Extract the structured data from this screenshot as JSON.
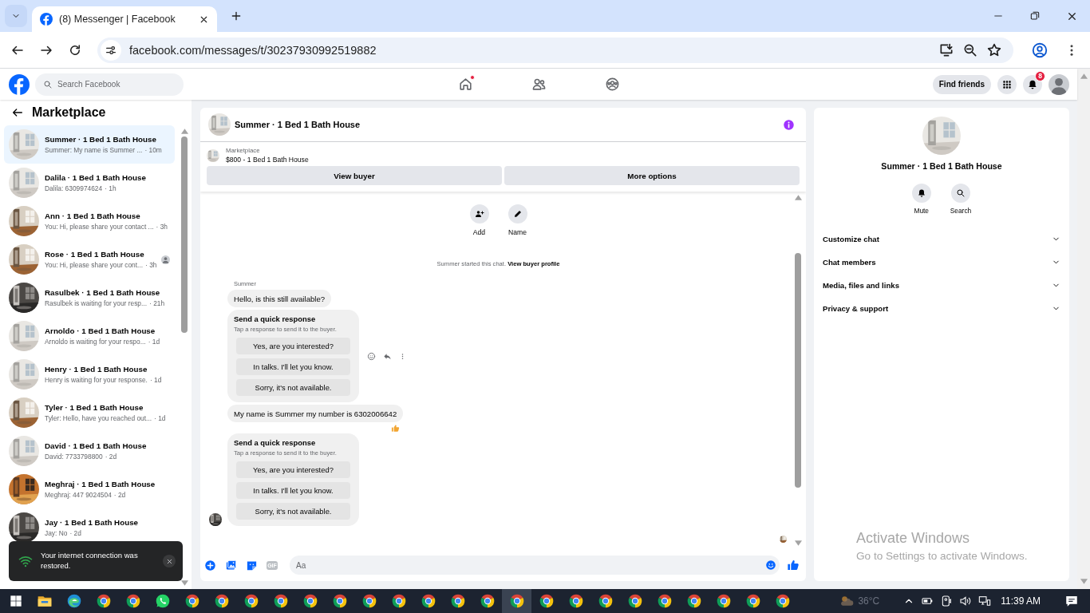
{
  "browser": {
    "tab_title": "(8) Messenger | Facebook",
    "url": "facebook.com/messages/t/30237930992519882"
  },
  "topbar": {
    "search_placeholder": "Search Facebook",
    "nav": [
      {
        "kind": "home",
        "has_dot": true
      },
      {
        "kind": "friends",
        "has_dot": false
      },
      {
        "kind": "groups",
        "has_dot": false
      }
    ],
    "find_friends": "Find friends",
    "notification_count": "8"
  },
  "sidebar": {
    "title": "Marketplace",
    "conversations": [
      {
        "title": "Summer · 1 Bed 1 Bath House",
        "preview": "Summer: My name is Summer ...",
        "time": "· 10m",
        "selected": true,
        "seen_avatar": false
      },
      {
        "title": "Dalila · 1 Bed 1 Bath House",
        "preview": "Dalila: 6309974624",
        "time": "· 1h",
        "selected": false,
        "seen_avatar": false
      },
      {
        "title": "Ann · 1 Bed 1 Bath House",
        "preview": "You: Hi, please share your contact ...",
        "time": "· 3h",
        "selected": false,
        "seen_avatar": false
      },
      {
        "title": "Rose · 1 Bed 1 Bath House",
        "preview": "You: Hi, please share your cont...",
        "time": "· 3h",
        "selected": false,
        "seen_avatar": true
      },
      {
        "title": "Rasulbek · 1 Bed 1 Bath House",
        "preview": "Rasulbek is waiting for your resp...",
        "time": "· 21h",
        "selected": false,
        "seen_avatar": false
      },
      {
        "title": "Arnoldo · 1 Bed 1 Bath House",
        "preview": "Arnoldo is waiting for your respo...",
        "time": "· 1d",
        "selected": false,
        "seen_avatar": false
      },
      {
        "title": "Henry · 1 Bed 1 Bath House",
        "preview": "Henry is waiting for your response.",
        "time": "· 1d",
        "selected": false,
        "seen_avatar": false
      },
      {
        "title": "Tyler · 1 Bed 1 Bath House",
        "preview": "Tyler: Hello, have you reached out...",
        "time": "· 1d",
        "selected": false,
        "seen_avatar": false
      },
      {
        "title": "David · 1 Bed 1 Bath House",
        "preview": "David: 7733798800",
        "time": "· 2d",
        "selected": false,
        "seen_avatar": false
      },
      {
        "title": "Meghraj · 1 Bed 1 Bath House",
        "preview": "Meghraj: 447 9024504",
        "time": "· 2d",
        "selected": false,
        "seen_avatar": false
      },
      {
        "title": "Jay · 1 Bed 1 Bath House",
        "preview": "Jay: No",
        "time": "· 2d",
        "selected": false,
        "seen_avatar": false
      }
    ]
  },
  "chat": {
    "title": "Summer · 1 Bed 1 Bath House",
    "listing": {
      "label": "Marketplace",
      "title": "$800 - 1 Bed 1 Bath House"
    },
    "buttons": [
      "View buyer",
      "More options"
    ],
    "actions": [
      {
        "kind": "add",
        "label": "Add"
      },
      {
        "kind": "name",
        "label": "Name"
      }
    ],
    "intro": {
      "text": "Summer started this chat.",
      "link": "View buyer profile"
    },
    "messages": [
      {
        "kind": "sender",
        "text": "Summer"
      },
      {
        "kind": "text",
        "text": "Hello, is this still available?",
        "reacted": false
      },
      {
        "kind": "quick_response",
        "title": "Send a quick response",
        "subtitle": "Tap a response to send it to the buyer.",
        "options": [
          "Yes, are you interested?",
          "In talks. I'll let you know.",
          "Sorry, it's not available."
        ],
        "hover_actions": true
      },
      {
        "kind": "text",
        "text": "My name is Summer my number is 6302006642",
        "reacted": true
      },
      {
        "kind": "quick_response",
        "title": "Send a quick response",
        "subtitle": "Tap a response to send it to the buyer.",
        "options": [
          "Yes, are you interested?",
          "In talks. I'll let you know.",
          "Sorry, it's not available."
        ],
        "hover_actions": false
      }
    ],
    "gif_label": "GIF",
    "composer_placeholder": "Aa"
  },
  "info_panel": {
    "name": "Summer · 1 Bed 1 Bath House",
    "actions": [
      {
        "kind": "mute",
        "label": "Mute"
      },
      {
        "kind": "search",
        "label": "Search"
      }
    ],
    "sections": [
      {
        "label": "Customize chat",
        "expanded": false
      },
      {
        "label": "Chat members",
        "expanded": false
      },
      {
        "label": "Media, files and links",
        "expanded": false
      },
      {
        "label": "Privacy & support",
        "expanded": false
      }
    ]
  },
  "toast": {
    "text": "Your internet connection was restored."
  },
  "activation_notice": {
    "title": "Activate Windows",
    "text": "Go to Settings to activate Windows."
  },
  "taskbar": {
    "apps": [
      {
        "kind": "explorer",
        "selected": false
      },
      {
        "kind": "edge",
        "selected": false
      },
      {
        "kind": "chrome",
        "selected": false
      },
      {
        "kind": "chrome",
        "selected": false
      },
      {
        "kind": "whatsapp",
        "selected": false
      },
      {
        "kind": "chrome",
        "selected": false
      },
      {
        "kind": "chrome",
        "selected": false
      },
      {
        "kind": "chrome",
        "selected": false
      },
      {
        "kind": "chrome",
        "selected": false
      },
      {
        "kind": "chrome",
        "selected": false
      },
      {
        "kind": "chrome",
        "selected": false
      },
      {
        "kind": "chrome",
        "selected": false
      },
      {
        "kind": "chrome",
        "selected": false
      },
      {
        "kind": "chrome",
        "selected": false
      },
      {
        "kind": "chrome",
        "selected": false
      },
      {
        "kind": "chrome",
        "selected": false
      },
      {
        "kind": "chrome",
        "selected": true
      },
      {
        "kind": "chrome",
        "selected": false
      },
      {
        "kind": "chrome",
        "selected": false
      },
      {
        "kind": "chrome",
        "selected": false
      },
      {
        "kind": "chrome",
        "selected": false
      },
      {
        "kind": "chrome",
        "selected": false
      },
      {
        "kind": "chrome",
        "selected": false
      },
      {
        "kind": "chrome",
        "selected": false
      },
      {
        "kind": "chrome",
        "selected": false
      },
      {
        "kind": "chrome",
        "selected": false
      }
    ],
    "weather": "36°C",
    "time": "11:39 AM"
  }
}
